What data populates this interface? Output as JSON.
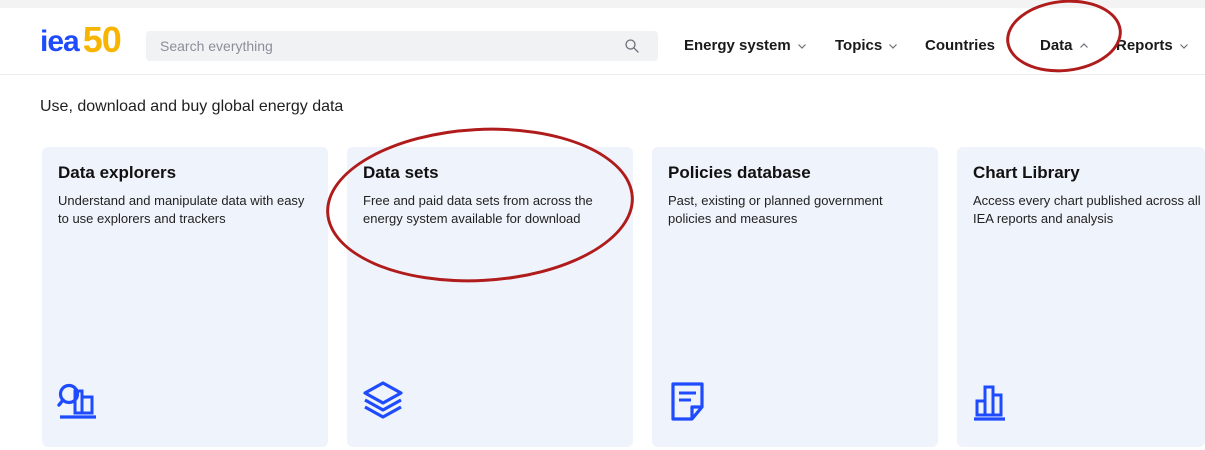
{
  "header": {
    "logo_text": "iea",
    "logo_number": "50",
    "search_placeholder": "Search everything",
    "nav": [
      {
        "label": "Energy system",
        "chevron": "chevron-down-icon"
      },
      {
        "label": "Topics",
        "chevron": "chevron-down-icon"
      },
      {
        "label": "Countries"
      },
      {
        "label": "Data",
        "chevron": "chevron-up-icon"
      },
      {
        "label": "Reports",
        "chevron": "chevron-down-icon"
      }
    ]
  },
  "main": {
    "intro": "Use, download and buy global energy data",
    "cards": [
      {
        "title": "Data explorers",
        "description": "Understand and manipulate data with easy to use explorers and trackers",
        "icon": "data-explorer-icon"
      },
      {
        "title": "Data sets",
        "description": "Free and paid data sets from across the energy system available for download",
        "icon": "layers-icon"
      },
      {
        "title": "Policies database",
        "description": "Past, existing or planned government policies and measures",
        "icon": "document-icon"
      },
      {
        "title": "Chart Library",
        "description": "Access every chart published across all IEA reports and analysis",
        "icon": "bar-chart-icon"
      }
    ]
  },
  "colors": {
    "brand_blue": "#1f4bff",
    "brand_yellow": "#f7b500",
    "card_bg": "#eff3fb",
    "annotation_red": "#b01b1b"
  }
}
